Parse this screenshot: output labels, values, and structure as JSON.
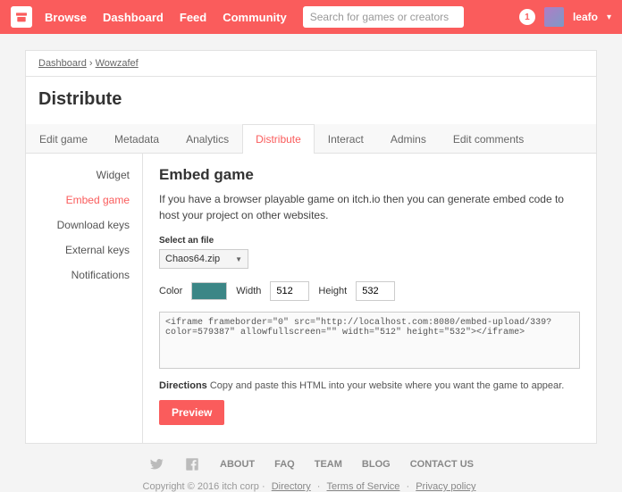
{
  "topnav": {
    "items": [
      "Browse",
      "Dashboard",
      "Feed",
      "Community"
    ]
  },
  "search": {
    "placeholder": "Search for games or creators"
  },
  "user": {
    "name": "leafo",
    "notif_count": "1"
  },
  "crumbs": {
    "dashboard": "Dashboard",
    "sep": "›",
    "project": "Wowzafef"
  },
  "page_title": "Distribute",
  "tabs": [
    "Edit game",
    "Metadata",
    "Analytics",
    "Distribute",
    "Interact",
    "Admins",
    "Edit comments"
  ],
  "active_tab": 3,
  "sidenav": [
    "Widget",
    "Embed game",
    "Download keys",
    "External keys",
    "Notifications"
  ],
  "active_side": 1,
  "content": {
    "heading": "Embed game",
    "desc": "If you have a browser playable game on itch.io then you can generate embed code to host your project on other websites.",
    "file_label": "Select an file",
    "file_selected": "Chaos64.zip",
    "color_label": "Color",
    "color_value": "#3b8686",
    "width_label": "Width",
    "width_value": "512",
    "height_label": "Height",
    "height_value": "532",
    "code": "<iframe frameborder=\"0\" src=\"http://localhost.com:8080/embed-upload/339?color=579387\" allowfullscreen=\"\" width=\"512\" height=\"532\"></iframe>",
    "directions_label": "Directions",
    "directions_text": " Copy and paste this HTML into your website where you want the game to appear.",
    "preview_btn": "Preview"
  },
  "footer": {
    "links": [
      "ABOUT",
      "FAQ",
      "TEAM",
      "BLOG",
      "CONTACT US"
    ],
    "copyright": "Copyright © 2016 itch corp ·",
    "legal": [
      "Directory",
      "Terms of Service",
      "Privacy policy"
    ]
  }
}
